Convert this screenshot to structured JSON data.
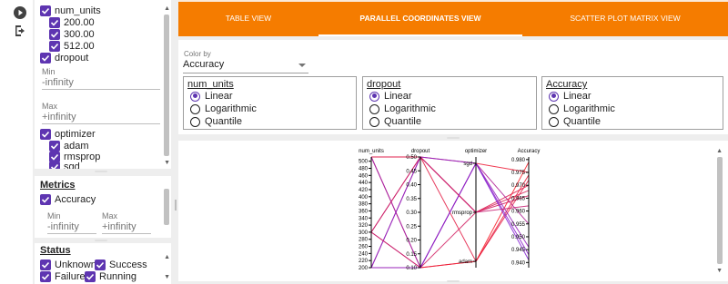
{
  "sidebar_rail": {
    "icons": [
      "play-circle-icon",
      "logout-icon"
    ]
  },
  "hparams": {
    "num_units": {
      "label": "num_units",
      "values": [
        "200.00",
        "300.00",
        "512.00"
      ]
    },
    "dropout": {
      "label": "dropout"
    },
    "min_label": "Min",
    "min_value": "-infinity",
    "max_label": "Max",
    "max_value": "+infinity",
    "optimizer": {
      "label": "optimizer",
      "values": [
        "adam",
        "rmsprop",
        "sgd"
      ]
    }
  },
  "metrics": {
    "title": "Metrics",
    "accuracy_label": "Accuracy",
    "min_label": "Min",
    "min_value": "-infinity",
    "max_label": "Max",
    "max_value": "+infinity"
  },
  "status": {
    "title": "Status",
    "items": [
      "Unknown",
      "Success",
      "Failure",
      "Running"
    ]
  },
  "tabs": [
    "TABLE VIEW",
    "PARALLEL COORDINATES VIEW",
    "SCATTER PLOT MATRIX VIEW"
  ],
  "active_tab": 1,
  "color_by": {
    "label": "Color by",
    "value": "Accuracy"
  },
  "scale_options": [
    "Linear",
    "Logarithmic",
    "Quantile"
  ],
  "scale_boxes": [
    {
      "title": "num_units",
      "selected": "Linear"
    },
    {
      "title": "dropout",
      "selected": "Linear"
    },
    {
      "title": "Accuracy",
      "selected": "Linear"
    }
  ],
  "colors": {
    "accent": "#f57c00",
    "checkbox": "#5e35b1",
    "line_low": "#7b1fe0",
    "line_high": "#ff1a1a"
  },
  "chart_data": {
    "type": "parallel_coordinates",
    "axes": [
      {
        "name": "num_units",
        "kind": "numeric",
        "range": [
          200,
          512
        ],
        "ticks": [
          500,
          480,
          460,
          440,
          420,
          400,
          380,
          360,
          340,
          320,
          300,
          280,
          260,
          240,
          220,
          200
        ]
      },
      {
        "name": "dropout",
        "kind": "numeric",
        "range": [
          0.1,
          0.5
        ],
        "ticks": [
          "0.50",
          "0.45",
          "0.40",
          "0.35",
          "0.30",
          "0.25",
          "0.20",
          "0.15",
          "0.10"
        ]
      },
      {
        "name": "optimizer",
        "kind": "categorical",
        "categories": [
          "sgd",
          "rmsprop",
          "adam"
        ]
      },
      {
        "name": "Accuracy",
        "kind": "numeric",
        "range": [
          0.938,
          0.981
        ],
        "ticks": [
          "0.980",
          "0.975",
          "0.970",
          "0.965",
          "0.960",
          "0.955",
          "0.950",
          "0.945",
          "0.940"
        ]
      }
    ],
    "sessions": [
      {
        "num_units": 512,
        "dropout": 0.5,
        "optimizer": "sgd",
        "Accuracy": 0.975
      },
      {
        "num_units": 512,
        "dropout": 0.1,
        "optimizer": "adam",
        "Accuracy": 0.979
      },
      {
        "num_units": 512,
        "dropout": 0.5,
        "optimizer": "rmsprop",
        "Accuracy": 0.97
      },
      {
        "num_units": 300,
        "dropout": 0.5,
        "optimizer": "adam",
        "Accuracy": 0.972
      },
      {
        "num_units": 300,
        "dropout": 0.1,
        "optimizer": "sgd",
        "Accuracy": 0.955
      },
      {
        "num_units": 200,
        "dropout": 0.5,
        "optimizer": "rmsprop",
        "Accuracy": 0.968
      },
      {
        "num_units": 200,
        "dropout": 0.1,
        "optimizer": "adam",
        "Accuracy": 0.974
      },
      {
        "num_units": 200,
        "dropout": 0.5,
        "optimizer": "sgd",
        "Accuracy": 0.941
      },
      {
        "num_units": 300,
        "dropout": 0.1,
        "optimizer": "rmsprop",
        "Accuracy": 0.966
      },
      {
        "num_units": 512,
        "dropout": 0.1,
        "optimizer": "sgd",
        "Accuracy": 0.946
      },
      {
        "num_units": 200,
        "dropout": 0.1,
        "optimizer": "sgd",
        "Accuracy": 0.943
      },
      {
        "num_units": 300,
        "dropout": 0.5,
        "optimizer": "rmsprop",
        "Accuracy": 0.962
      }
    ]
  }
}
